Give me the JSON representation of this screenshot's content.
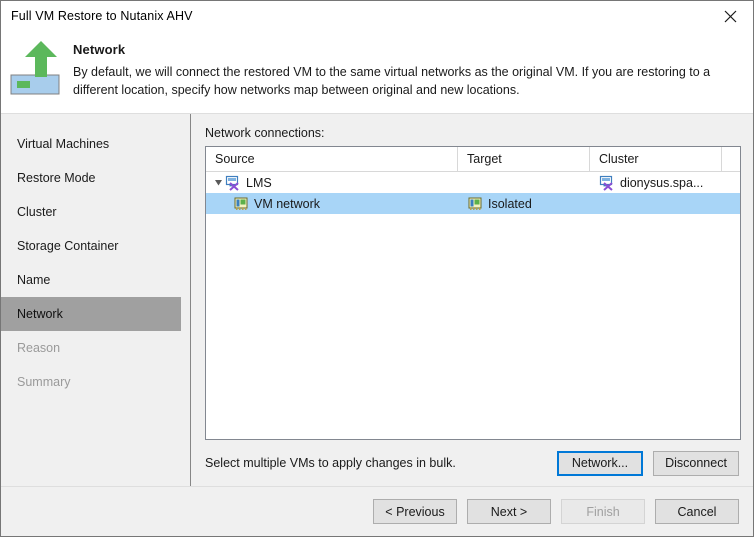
{
  "window": {
    "title": "Full VM Restore to Nutanix AHV",
    "close_label": "✕"
  },
  "header": {
    "icon": "restore-arrow-icon",
    "title": "Network",
    "description": "By default, we will connect the restored VM to the same virtual networks as the original VM. If you are restoring to a different location, specify how networks map between original and new locations."
  },
  "sidebar": {
    "items": [
      {
        "label": "Virtual Machines",
        "state": "normal"
      },
      {
        "label": "Restore Mode",
        "state": "normal"
      },
      {
        "label": "Cluster",
        "state": "normal"
      },
      {
        "label": "Storage Container",
        "state": "normal"
      },
      {
        "label": "Name",
        "state": "normal"
      },
      {
        "label": "Network",
        "state": "selected"
      },
      {
        "label": "Reason",
        "state": "disabled"
      },
      {
        "label": "Summary",
        "state": "disabled"
      }
    ]
  },
  "main": {
    "panel_label": "Network connections:",
    "grid": {
      "columns": [
        "Source",
        "Target",
        "Cluster",
        ""
      ],
      "rows": [
        {
          "level": 0,
          "expanded": true,
          "source_icon": "host-disconnected-icon",
          "source": "LMS",
          "target_icon": "",
          "target": "",
          "cluster_icon": "host-disconnected-icon",
          "cluster": "dionysus.spa...",
          "selected": false
        },
        {
          "level": 1,
          "expanded": false,
          "source_icon": "network-adapter-icon",
          "source": "VM network",
          "target_icon": "network-adapter-icon",
          "target": "Isolated",
          "cluster_icon": "",
          "cluster": "",
          "selected": true
        }
      ]
    },
    "bulk_hint": "Select multiple VMs to apply changes in bulk.",
    "network_button": "Network...",
    "disconnect_button": "Disconnect"
  },
  "footer": {
    "previous": "< Previous",
    "next": "Next >",
    "finish": "Finish",
    "cancel": "Cancel"
  },
  "colors": {
    "accent": "#0078d7",
    "selection": "#a8d5f7",
    "nav_selected": "#a0a0a0",
    "dialog_bg": "#f0f0f0",
    "arrow_green": "#5cb85c"
  }
}
